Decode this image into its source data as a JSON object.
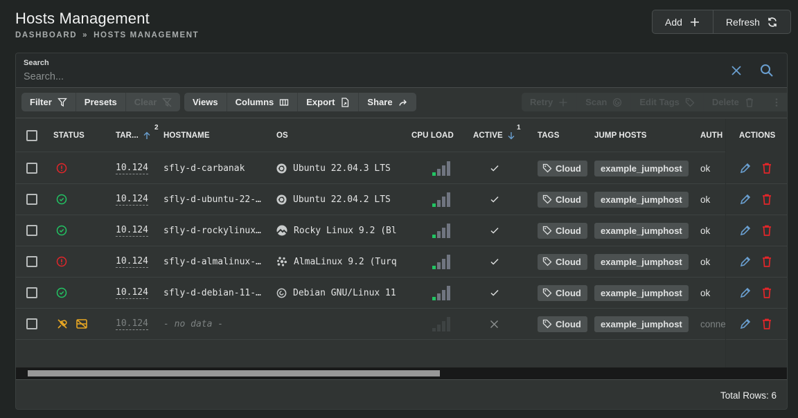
{
  "header": {
    "title": "Hosts Management",
    "breadcrumb": [
      "DASHBOARD",
      "HOSTS MANAGEMENT"
    ],
    "breadcrumb_separator": "»",
    "actions": [
      {
        "label": "Add",
        "icon": "plus-icon"
      },
      {
        "label": "Refresh",
        "icon": "refresh-icon"
      }
    ]
  },
  "search": {
    "label": "Search",
    "placeholder": "Search...",
    "value": ""
  },
  "toolbar": {
    "filter_group": [
      {
        "label": "Filter",
        "icon": "filter-icon",
        "disabled": false
      },
      {
        "label": "Presets",
        "disabled": false
      },
      {
        "label": "Clear",
        "icon": "filter-clear-icon",
        "disabled": true
      }
    ],
    "view_group": [
      {
        "label": "Views"
      },
      {
        "label": "Columns",
        "icon": "columns-icon"
      },
      {
        "label": "Export",
        "icon": "export-file-icon"
      },
      {
        "label": "Share",
        "icon": "share-icon"
      }
    ],
    "bulk_group": [
      {
        "label": "Retry",
        "icon": "plus-icon",
        "disabled": true
      },
      {
        "label": "Scan",
        "icon": "scan-icon",
        "disabled": true
      },
      {
        "label": "Edit Tags",
        "icon": "tags-icon",
        "disabled": true
      },
      {
        "label": "Delete",
        "icon": "trash-icon",
        "disabled": true
      },
      {
        "label": "",
        "icon": "more-vertical-icon",
        "disabled": true
      }
    ]
  },
  "table": {
    "columns": {
      "status": "STATUS",
      "target": "TAR...",
      "target_sort": {
        "direction": "asc",
        "index": "2"
      },
      "hostname": "HOSTNAME",
      "os": "OS",
      "cpu": "CPU LOAD",
      "active": "ACTIVE",
      "active_sort": {
        "direction": "desc",
        "index": "1"
      },
      "tags": "TAGS",
      "jump": "JUMP HOSTS",
      "auth": "AUTH :",
      "actions": "ACTIONS"
    },
    "rows": [
      {
        "status": "error",
        "target": "10.124",
        "hostname": "sfly-d-carbanak",
        "os_icon": "ubuntu",
        "os": "Ubuntu 22.04.3 LTS",
        "cpu_load_level": 1,
        "cpu_load_max": 4,
        "active": true,
        "tag": "Cloud",
        "jump_host": "example_jumphost",
        "auth": "ok"
      },
      {
        "status": "ok",
        "target": "10.124",
        "hostname": "sfly-d-ubuntu-22-…",
        "os_icon": "ubuntu",
        "os": "Ubuntu 22.04.2 LTS",
        "cpu_load_level": 1,
        "cpu_load_max": 4,
        "active": true,
        "tag": "Cloud",
        "jump_host": "example_jumphost",
        "auth": "ok"
      },
      {
        "status": "ok",
        "target": "10.124",
        "hostname": "sfly-d-rockylinux…",
        "os_icon": "rocky",
        "os": "Rocky Linux 9.2 (Bl",
        "cpu_load_level": 1,
        "cpu_load_max": 4,
        "active": true,
        "tag": "Cloud",
        "jump_host": "example_jumphost",
        "auth": "ok"
      },
      {
        "status": "error",
        "target": "10.124",
        "hostname": "sfly-d-almalinux-…",
        "os_icon": "alma",
        "os": "AlmaLinux 9.2 (Turq",
        "cpu_load_level": 1,
        "cpu_load_max": 4,
        "active": true,
        "tag": "Cloud",
        "jump_host": "example_jumphost",
        "auth": "ok"
      },
      {
        "status": "ok",
        "target": "10.124",
        "hostname": "sfly-d-debian-11-…",
        "os_icon": "debian",
        "os": "Debian GNU/Linux 11",
        "cpu_load_level": 1,
        "cpu_load_max": 4,
        "active": true,
        "tag": "Cloud",
        "jump_host": "example_jumphost",
        "auth": "ok"
      },
      {
        "status": "unreachable",
        "target": "10.124",
        "hostname": "- no data -",
        "os_icon": "",
        "os": "",
        "cpu_load_level": 0,
        "cpu_load_max": 4,
        "active": false,
        "tag": "Cloud",
        "jump_host": "example_jumphost",
        "auth": "conne"
      }
    ]
  },
  "scrollbar": {
    "horizontal_thumb_fraction": 0.55
  },
  "footer": {
    "total_rows": "Total Rows: 6"
  },
  "colors": {
    "error": "#e3262a",
    "ok": "#22c463",
    "warning": "#e7a623",
    "accent": "#6a9fd0",
    "delete": "#e3262a"
  }
}
